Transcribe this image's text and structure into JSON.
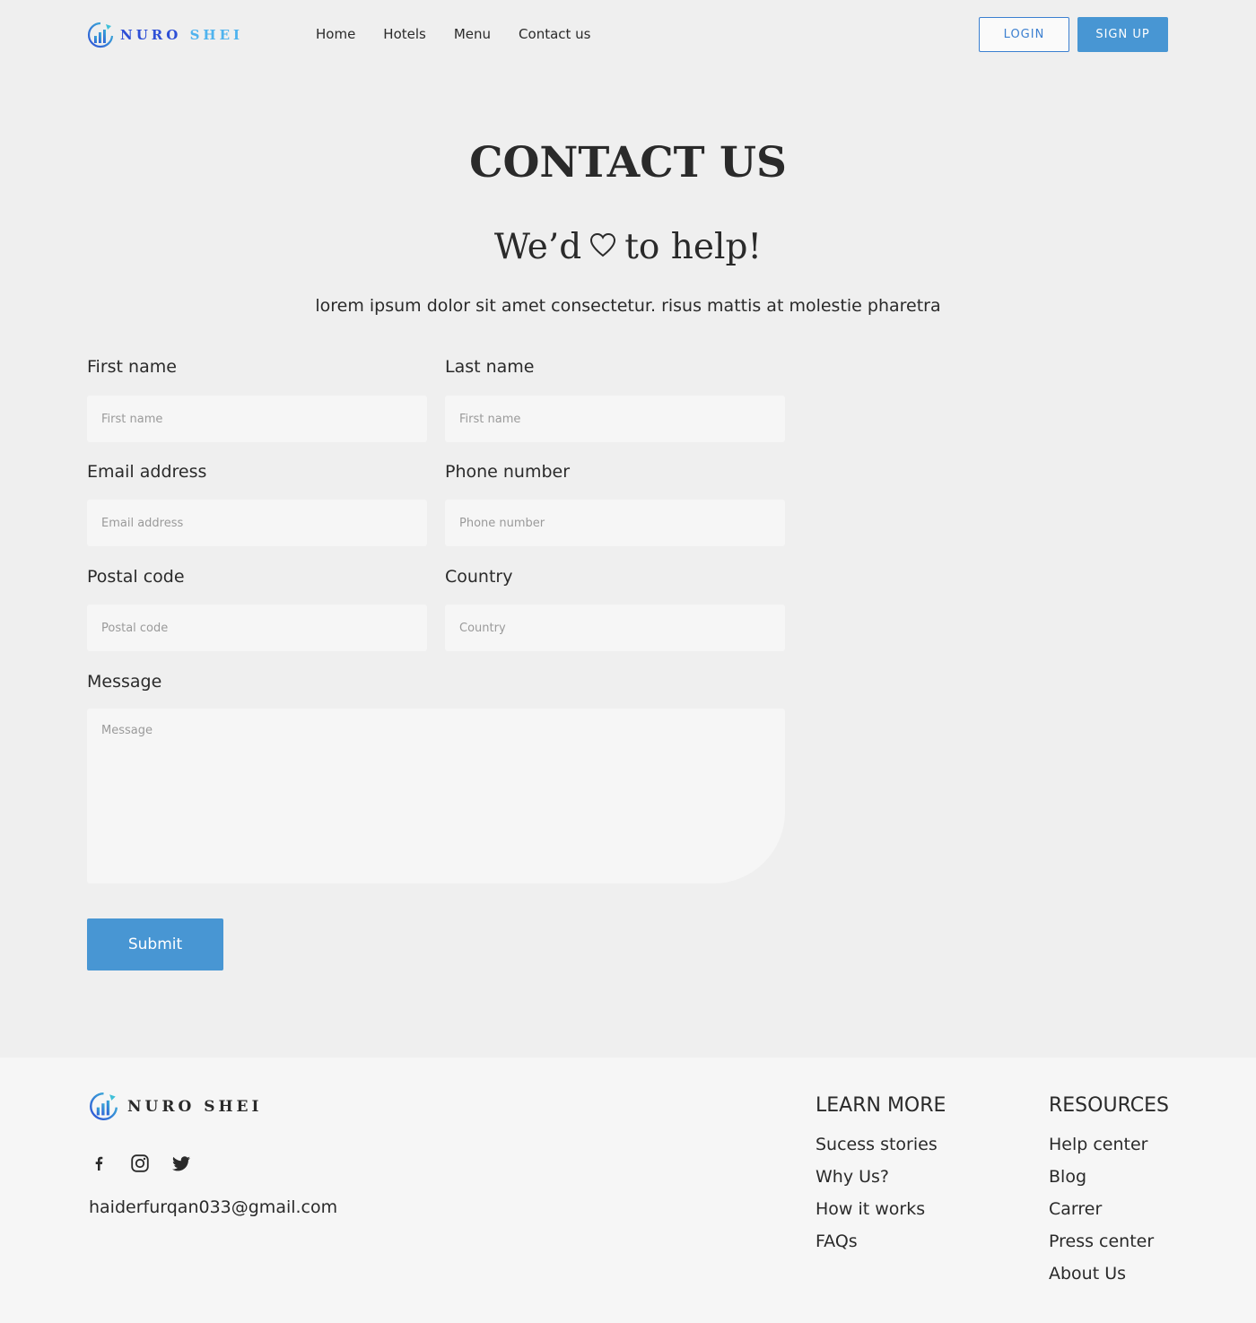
{
  "brand": {
    "word1": "NURO",
    "word2": "SHEI",
    "footer_name": "NURO SHEI"
  },
  "nav": {
    "items": [
      "Home",
      "Hotels",
      "Menu",
      "Contact us"
    ]
  },
  "header": {
    "login_label": "LOGIN",
    "signup_label": "SIGN UP"
  },
  "hero": {
    "title": "CONTACT US",
    "subtitle_before": "We’d",
    "subtitle_after": "to help!",
    "lead": "lorem ipsum dolor sit amet consectetur. risus mattis at molestie pharetra"
  },
  "form": {
    "first_name": {
      "label": "First name",
      "placeholder": "First name"
    },
    "last_name": {
      "label": "Last name",
      "placeholder": "First name"
    },
    "email": {
      "label": "Email address",
      "placeholder": "Email address"
    },
    "phone": {
      "label": "Phone number",
      "placeholder": "Phone number"
    },
    "postal": {
      "label": "Postal code",
      "placeholder": "Postal code"
    },
    "country": {
      "label": "Country",
      "placeholder": "Country"
    },
    "message": {
      "label": "Message",
      "placeholder": "Message"
    },
    "submit_label": "Submit"
  },
  "footer": {
    "email": "haiderfurqan033@gmail.com",
    "learn_more": {
      "heading": "LEARN MORE",
      "links": [
        "Sucess stories",
        "Why Us?",
        "How it works",
        "FAQs"
      ]
    },
    "resources": {
      "heading": "RESOURCES",
      "links": [
        "Help center",
        "Blog",
        "Carrer",
        "Press center",
        "About Us"
      ]
    },
    "social_icons": [
      "facebook-icon",
      "instagram-icon",
      "twitter-icon"
    ]
  },
  "colors": {
    "accent": "#4896d3",
    "login_border": "#3b7fd0",
    "brand_blue": "#2e4fd6",
    "brand_light": "#4fb3ee"
  }
}
